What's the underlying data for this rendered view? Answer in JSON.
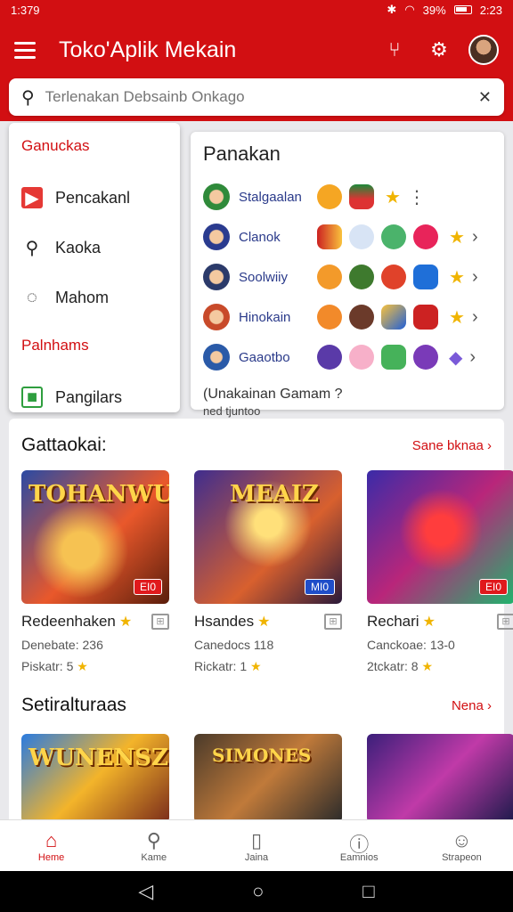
{
  "status": {
    "time": "1:379",
    "battery": "39%",
    "clock": "2:23"
  },
  "appbar": {
    "title": "Toko'Aplik Mekain"
  },
  "search": {
    "placeholder": "Terlenakan Debsainb Onkago"
  },
  "drawer": {
    "section1": "Ganuckas",
    "items1": [
      {
        "label": "Pencakanl",
        "icon": "store-icon"
      },
      {
        "label": "Kaoka",
        "icon": "search-icon"
      },
      {
        "label": "Mahom",
        "icon": "chat-icon"
      }
    ],
    "section2": "Palnhams",
    "items2": [
      {
        "label": "Pangilars",
        "icon": "library-icon"
      }
    ]
  },
  "panel": {
    "title": "Panakan",
    "rows": [
      {
        "name": "Stalgaalan"
      },
      {
        "name": "Clanok"
      },
      {
        "name": "Soolwiiy"
      },
      {
        "name": "Hinokain"
      },
      {
        "name": "Gaaotbo"
      }
    ],
    "footer": "(Unakainan Gamam ?"
  },
  "peek": "ned tjuntoo",
  "section_a": {
    "title": "Gattaokai:",
    "more": "Sane bknaa",
    "cards": [
      {
        "name": "Redeenhaken",
        "meta1": "Denebate: 236",
        "meta2": "Piskatr: 5",
        "tag": "ΕΙ0",
        "banner": "TOHANWUNS"
      },
      {
        "name": "Hsandes",
        "meta1": "Canedocs 118",
        "meta2": "Rickatr: 1",
        "tag": "ΜΙ0",
        "banner": "MEAIZ"
      },
      {
        "name": "Rechari",
        "meta1": "Canckoae: 13-0",
        "meta2": "2tckatr: 8",
        "tag": "ΕΙ0",
        "banner": ""
      }
    ]
  },
  "section_b": {
    "title": "Setiralturaas",
    "more": "Nena",
    "cards": [
      {
        "banner": "WUNENSZ"
      },
      {
        "banner": "SIMONES"
      },
      {
        "banner": ""
      }
    ]
  },
  "bottomnav": [
    {
      "label": "Heme",
      "icon": "home-icon",
      "active": true
    },
    {
      "label": "Kame",
      "icon": "search-icon"
    },
    {
      "label": "Jaina",
      "icon": "library-icon"
    },
    {
      "label": "Eamnios",
      "icon": "info-icon"
    },
    {
      "label": "Strapeon",
      "icon": "profile-icon"
    }
  ],
  "colors": {
    "brand": "#d20f12",
    "star": "#f0b400",
    "link": "#2a3a8a"
  }
}
